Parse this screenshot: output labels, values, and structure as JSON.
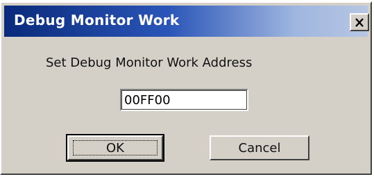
{
  "dialog": {
    "title": "Debug Monitor Work",
    "close_icon": "close-icon",
    "prompt": "Set Debug Monitor Work Address",
    "address_value": "00FF00",
    "ok_label": "OK",
    "cancel_label": "Cancel"
  },
  "colors": {
    "title_gradient_start": "#0a2a7a",
    "title_gradient_end": "#b7c6e4",
    "dialog_face": "#d4d0c8"
  }
}
